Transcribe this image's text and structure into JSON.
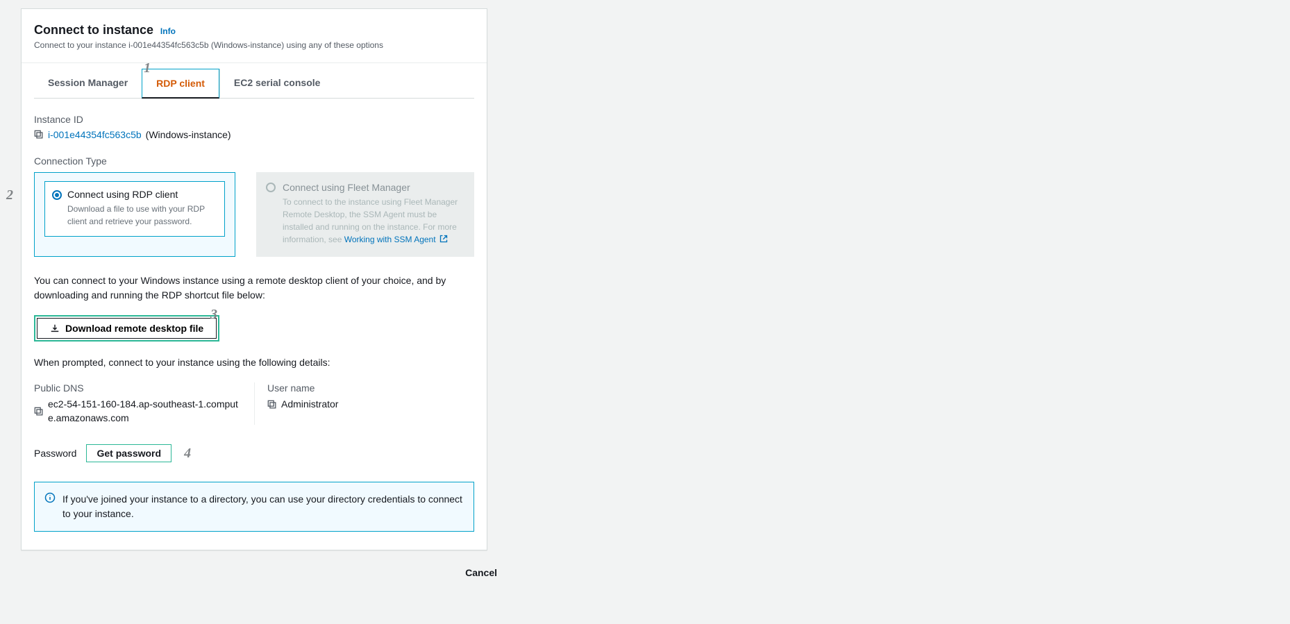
{
  "header": {
    "title": "Connect to instance",
    "info_label": "Info",
    "subtitle": "Connect to your instance i-001e44354fc563c5b (Windows-instance) using any of these options"
  },
  "tabs": [
    {
      "label": "Session Manager"
    },
    {
      "label": "RDP client"
    },
    {
      "label": "EC2 serial console"
    }
  ],
  "instance": {
    "label": "Instance ID",
    "id": "i-001e44354fc563c5b",
    "name": "(Windows-instance)"
  },
  "connection": {
    "label": "Connection Type",
    "rdp": {
      "title": "Connect using RDP client",
      "desc": "Download a file to use with your RDP client and retrieve your password."
    },
    "fleet": {
      "title": "Connect using Fleet Manager",
      "desc": "To connect to the instance using Fleet Manager Remote Desktop, the SSM Agent must be installed and running on the instance. For more information, see ",
      "link": "Working with SSM Agent"
    }
  },
  "text": {
    "intro": "You can connect to your Windows instance using a remote desktop client of your choice, and by downloading and running the RDP shortcut file below:",
    "download_btn": "Download remote desktop file",
    "prompt": "When prompted, connect to your instance using the following details:"
  },
  "details": {
    "dns_label": "Public DNS",
    "dns_value": "ec2-54-151-160-184.ap-southeast-1.compute.amazonaws.com",
    "user_label": "User name",
    "user_value": "Administrator"
  },
  "password": {
    "label": "Password",
    "button": "Get password"
  },
  "info_box": "If you've joined your instance to a directory, you can use your directory credentials to connect to your instance.",
  "footer": {
    "cancel": "Cancel"
  },
  "annotations": {
    "a1": "1",
    "a2": "2",
    "a3": "3",
    "a4": "4"
  }
}
